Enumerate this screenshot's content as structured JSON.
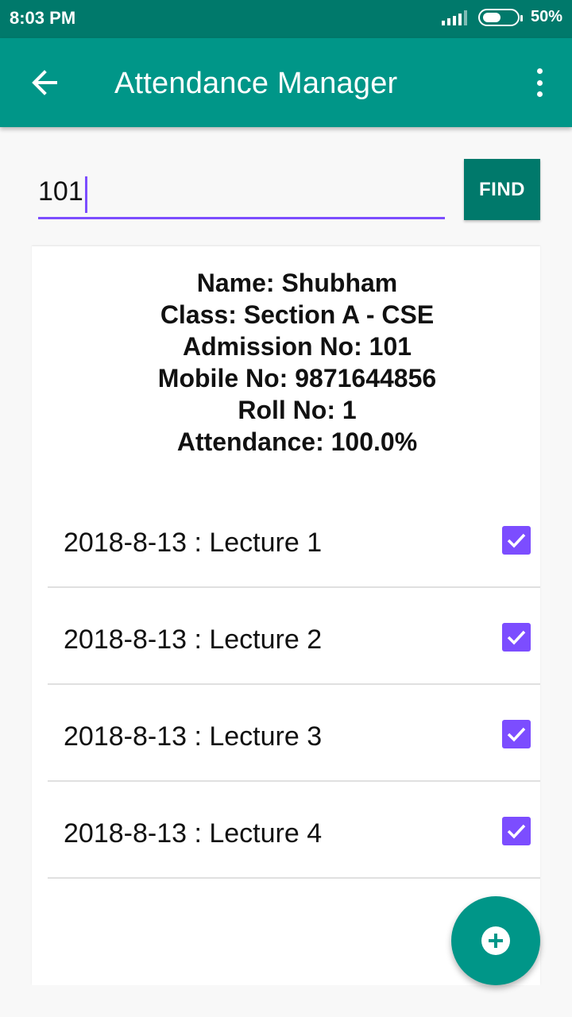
{
  "status_bar": {
    "time": "8:03 PM",
    "battery": "50%"
  },
  "app_bar": {
    "title": "Attendance Manager",
    "back_icon": "arrow-back-icon",
    "menu_icon": "more-vert-icon"
  },
  "search": {
    "value": "101",
    "button_label": "FIND"
  },
  "student": {
    "name": "Name: Shubham",
    "class": "Class: Section A - CSE",
    "admission": "Admission No: 101",
    "mobile": "Mobile No: 9871644856",
    "roll": "Roll No: 1",
    "attendance": "Attendance: 100.0%"
  },
  "lectures": [
    {
      "label": "2018-8-13 : Lecture 1",
      "checked": true
    },
    {
      "label": "2018-8-13 : Lecture 2",
      "checked": true
    },
    {
      "label": "2018-8-13 : Lecture 3",
      "checked": true
    },
    {
      "label": "2018-8-13 : Lecture 4",
      "checked": true
    }
  ],
  "fab": {
    "icon": "add-circle-icon"
  },
  "colors": {
    "primary": "#009688",
    "primary_dark": "#00796b",
    "accent": "#7c4dff"
  }
}
